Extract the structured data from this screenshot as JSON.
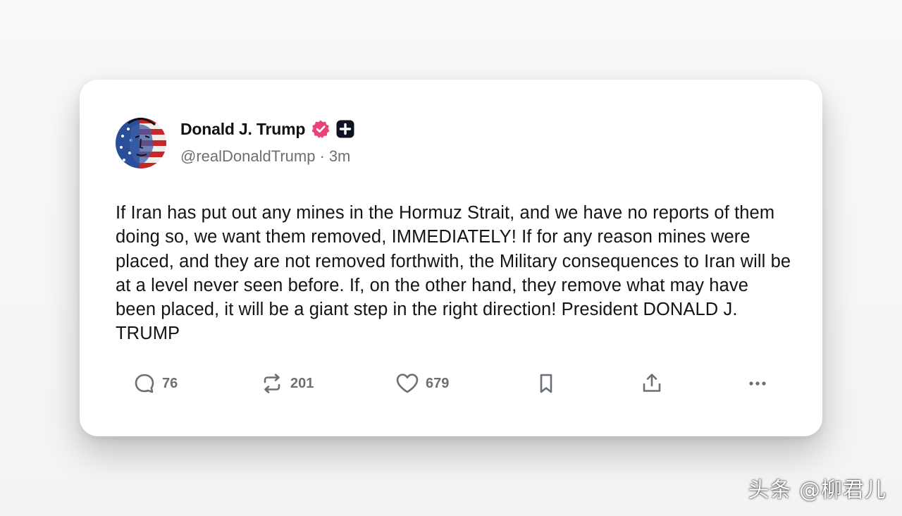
{
  "post": {
    "author": {
      "display_name": "Donald J. Trump",
      "verified_icon": "verified-badge-icon",
      "plus_icon": "plus-badge-icon",
      "handle": "@realDonaldTrump",
      "separator": "·",
      "time": "3m"
    },
    "text": "If Iran has put out any mines in the Hormuz Strait, and we have no reports of them doing so, we want them removed, IMMEDIATELY! If for any reason mines were placed, and they are not removed forthwith, the Military consequences to Iran will be at a level never seen before. If, on the other hand, they remove what may have been placed, it will be a giant step in the right direction! President DONALD J. TRUMP",
    "actions": {
      "replies": {
        "icon": "reply-icon",
        "count": "76"
      },
      "reposts": {
        "icon": "repost-icon",
        "count": "201"
      },
      "likes": {
        "icon": "heart-icon",
        "count": "679"
      },
      "bookmark": {
        "icon": "bookmark-icon"
      },
      "share": {
        "icon": "share-icon"
      },
      "more": {
        "icon": "more-icon"
      }
    }
  },
  "watermark": "头条 @柳君儿",
  "colors": {
    "verified_badge": "#e8437a",
    "icon_gray": "#6b6f76",
    "text": "#141414"
  }
}
